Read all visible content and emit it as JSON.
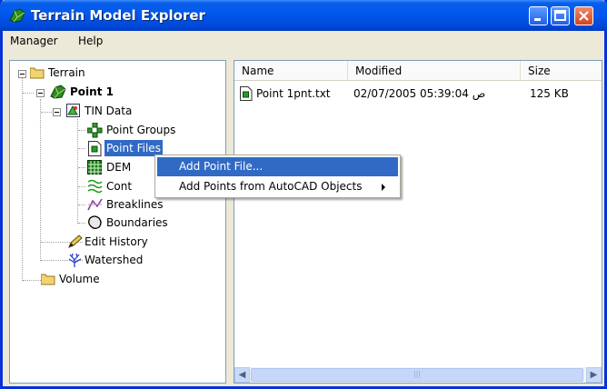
{
  "window": {
    "title": "Terrain Model Explorer"
  },
  "menubar": {
    "items": [
      "Manager",
      "Help"
    ]
  },
  "tree": {
    "terrain": "Terrain",
    "point1": "Point 1",
    "tin_data": "TIN Data",
    "point_groups": "Point Groups",
    "point_files": "Point Files",
    "dem": "DEM",
    "contours": "Cont",
    "breaklines": "Breaklines",
    "boundaries": "Boundaries",
    "edit_history": "Edit History",
    "watershed": "Watershed",
    "volume": "Volume"
  },
  "list": {
    "columns": [
      "Name",
      "Modified",
      "Size"
    ],
    "rows": [
      {
        "name": "Point 1pnt.txt",
        "modified": "02/07/2005 05:39:04 ص",
        "size": "125 KB"
      }
    ]
  },
  "context_menu": {
    "items": [
      {
        "label": "Add Point File...",
        "submenu": false
      },
      {
        "label": "Add Points from AutoCAD Objects",
        "submenu": true
      }
    ]
  },
  "colors": {
    "title_bar": "#0058ee",
    "selection": "#316ac5",
    "folder": "#f3d36e"
  },
  "icons": [
    "terrain-app-icon",
    "folder-icon",
    "surface-icon",
    "tin-data-icon",
    "point-groups-icon",
    "point-file-icon",
    "dem-icon",
    "contours-icon",
    "breaklines-icon",
    "boundaries-icon",
    "edit-history-icon",
    "watershed-icon",
    "text-file-icon"
  ]
}
